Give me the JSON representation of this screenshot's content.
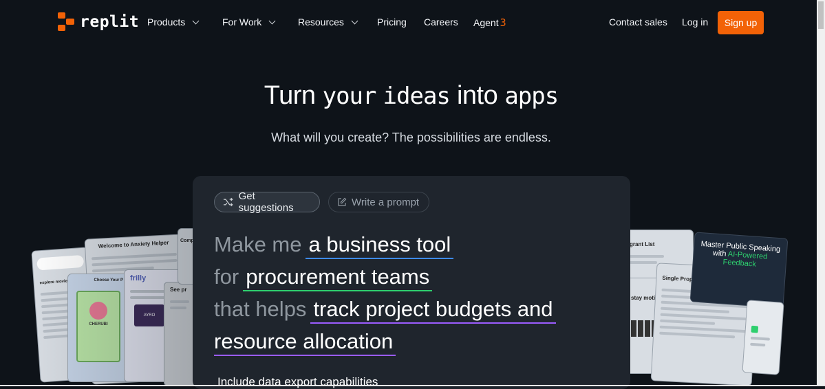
{
  "brand": {
    "name": "replit"
  },
  "nav": {
    "items": [
      {
        "label": "Products",
        "has_dropdown": true
      },
      {
        "label": "For Work",
        "has_dropdown": true
      },
      {
        "label": "Resources",
        "has_dropdown": true
      },
      {
        "label": "Pricing",
        "has_dropdown": false
      },
      {
        "label": "Careers",
        "has_dropdown": false
      }
    ],
    "agent": {
      "label": "Agent",
      "version": "3"
    },
    "contact_sales": "Contact sales",
    "login": "Log in",
    "signup": "Sign up"
  },
  "hero": {
    "title_part1": "Turn",
    "title_part2": "your",
    "title_part3": "ideas",
    "title_part4": "into",
    "title_part5": "apps",
    "subtitle": "What will you create? The possibilities are endless."
  },
  "prompt_panel": {
    "chips": {
      "suggestions": "Get suggestions",
      "write": "Write a prompt"
    },
    "lines": {
      "l1_prefix": "Make me",
      "l1_value": "a business tool",
      "l2_prefix": "for",
      "l2_value": "procurement teams",
      "l3_prefix": "that helps",
      "l3_value": "track project budgets and",
      "l4_value": "resource allocation"
    },
    "extra_feature": "Include data export capabilities"
  },
  "showcase_cards": {
    "anxiety": "Welcome to Anxiety Helper",
    "movies": "explore movies",
    "frilly": "frilly",
    "choose": "Choose Your P",
    "see": "See pr",
    "comp": "Comp",
    "grant": "grant List",
    "stay": "stay motivated",
    "loan_title": "Single Property Loan Calculator",
    "public_speaking_1": "Master Public Speaking",
    "public_speaking_2": "with",
    "public_speaking_3": "AI-Powered",
    "public_speaking_4": "Feedback",
    "cherubi": "CHERUBI",
    "ayro": "AYRO"
  },
  "colors": {
    "background": "#0e1319",
    "accent": "#f26207",
    "panel": "#1f252d",
    "underline_blue": "#3d8bfd",
    "underline_green": "#2ecf6e",
    "underline_purple": "#9b5cff"
  }
}
